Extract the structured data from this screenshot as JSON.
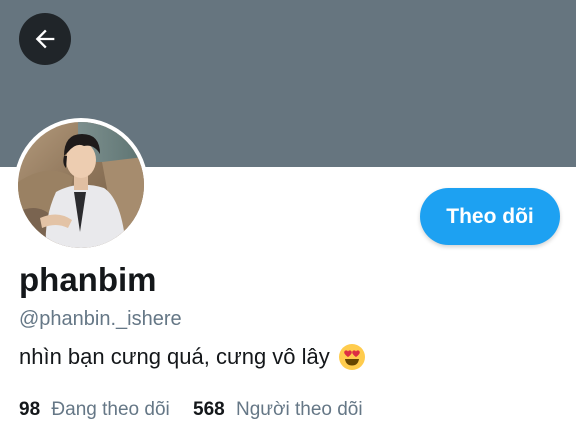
{
  "header": {
    "back_icon": "arrow-left-icon",
    "banner_color": "#66757f"
  },
  "profile": {
    "display_name": "phanbim",
    "handle": "@phanbin._ishere",
    "bio": "nhìn bạn cưng quá, cưng vô lây",
    "bio_emoji": "heart-eyes-emoji",
    "avatar": "profile-photo"
  },
  "actions": {
    "follow_label": "Theo dõi",
    "follow_color": "#1da1f2"
  },
  "stats": {
    "following_count": "98",
    "following_label": "Đang theo dõi",
    "followers_count": "568",
    "followers_label": "Người theo dõi"
  }
}
